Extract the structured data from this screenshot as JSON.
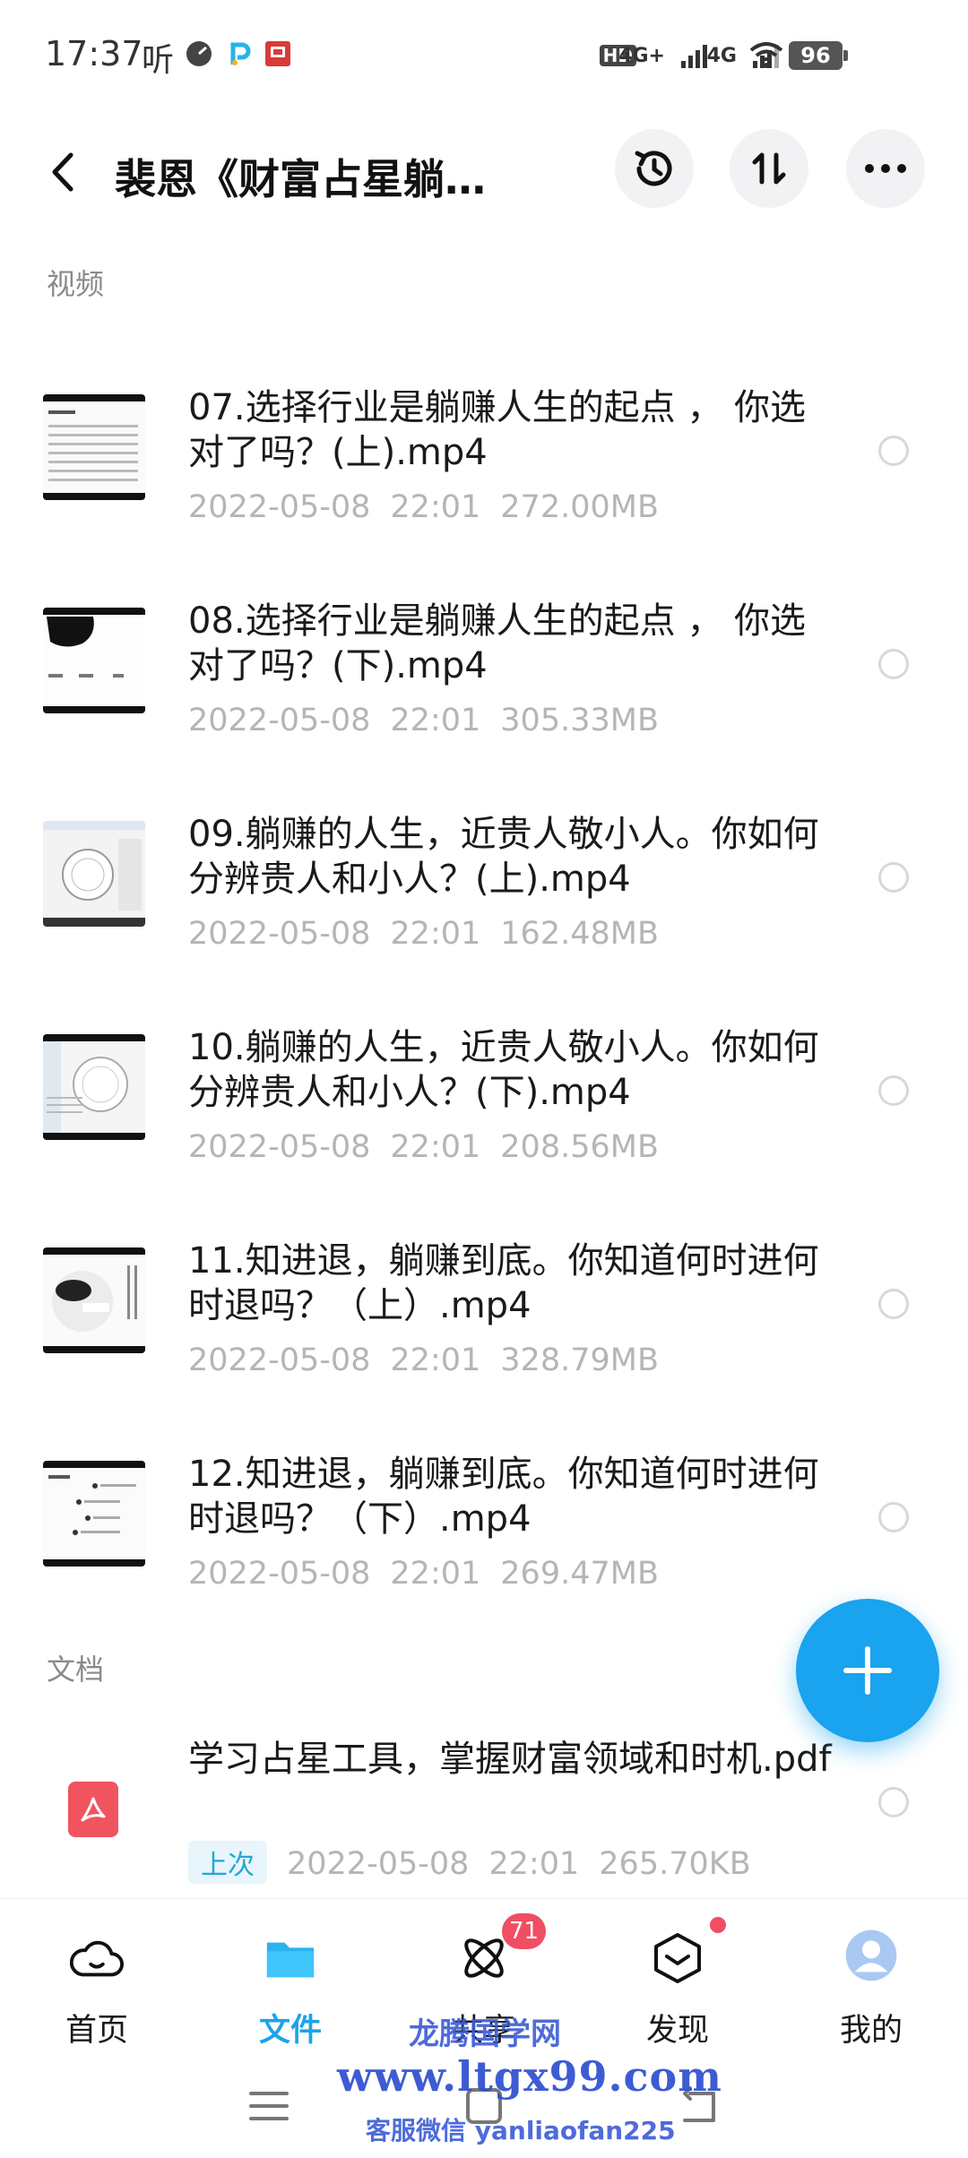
{
  "status_bar": {
    "time": "17:37",
    "listen": "听",
    "network_1": "4G+",
    "network_2": "4G",
    "hd": "HD",
    "battery": "96"
  },
  "header": {
    "title": "裴恩《财富占星躺…"
  },
  "sections": {
    "video_label": "视频",
    "doc_label": "文档"
  },
  "videos": [
    {
      "name": "07.选择行业是躺赚人生的起点 ， 你选对了吗？(上).mp4",
      "date": "2022-05-08",
      "time": "22:01",
      "size": "272.00MB"
    },
    {
      "name": "08.选择行业是躺赚人生的起点 ， 你选对了吗？(下).mp4",
      "date": "2022-05-08",
      "time": "22:01",
      "size": "305.33MB"
    },
    {
      "name": "09.躺赚的人生，近贵人敬小人。你如何分辨贵人和小人？(上).mp4",
      "date": "2022-05-08",
      "time": "22:01",
      "size": "162.48MB"
    },
    {
      "name": "10.躺赚的人生，近贵人敬小人。你如何分辨贵人和小人？(下).mp4",
      "date": "2022-05-08",
      "time": "22:01",
      "size": "208.56MB"
    },
    {
      "name": "11.知进退，躺赚到底。你知道何时进何时退吗？（上）.mp4",
      "date": "2022-05-08",
      "time": "22:01",
      "size": "328.79MB"
    },
    {
      "name": "12.知进退，躺赚到底。你知道何时进何时退吗？（下）.mp4",
      "date": "2022-05-08",
      "time": "22:01",
      "size": "269.47MB"
    }
  ],
  "documents": [
    {
      "name": "学习占星工具，掌握财富领域和时机.pdf",
      "tag": "上次",
      "date": "2022-05-08",
      "time": "22:01",
      "size": "265.70KB"
    }
  ],
  "bottom_nav": {
    "home": "首页",
    "files": "文件",
    "share": "共享",
    "discover": "发现",
    "me": "我的",
    "share_badge": "71"
  },
  "watermark": {
    "line1": "龙腾国学网",
    "line2": "www.ltgx99.com",
    "line3": "客服微信 yanliaofan225"
  },
  "colors": {
    "accent": "#1aa3ee",
    "badge": "#f04e63",
    "meta": "#b5b5b5"
  }
}
